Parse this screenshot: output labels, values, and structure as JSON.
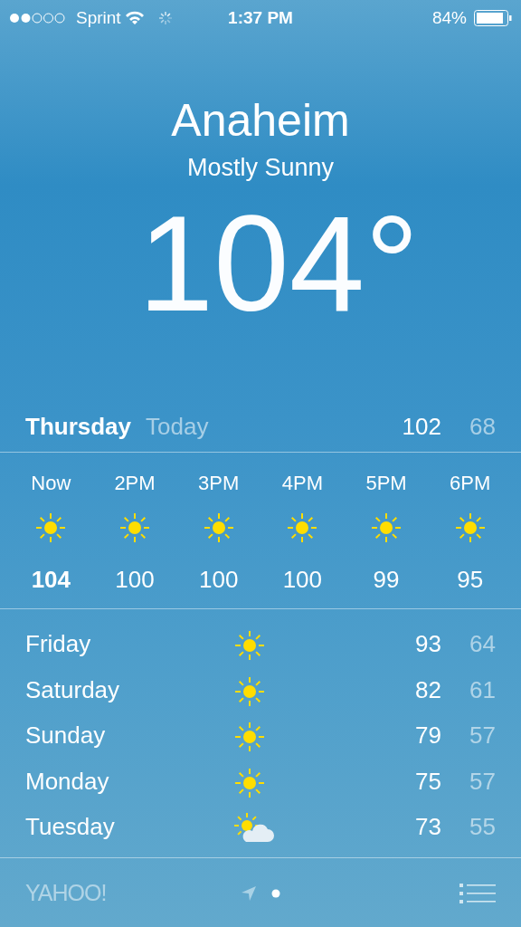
{
  "status_bar": {
    "carrier": "Sprint",
    "time": "1:37 PM",
    "battery": "84%"
  },
  "location": {
    "city": "Anaheim",
    "condition": "Mostly Sunny",
    "temperature": "104°"
  },
  "today": {
    "day": "Thursday",
    "label": "Today",
    "high": "102",
    "low": "68"
  },
  "hourly": [
    {
      "time": "Now",
      "kind": "sunny",
      "temp": "104",
      "current": true
    },
    {
      "time": "2PM",
      "kind": "sunny",
      "temp": "100",
      "current": false
    },
    {
      "time": "3PM",
      "kind": "sunny",
      "temp": "100",
      "current": false
    },
    {
      "time": "4PM",
      "kind": "sunny",
      "temp": "100",
      "current": false
    },
    {
      "time": "5PM",
      "kind": "sunny",
      "temp": "99",
      "current": false
    },
    {
      "time": "6PM",
      "kind": "sunny",
      "temp": "95",
      "current": false
    }
  ],
  "daily": [
    {
      "day": "Friday",
      "kind": "sunny",
      "high": "93",
      "low": "64"
    },
    {
      "day": "Saturday",
      "kind": "sunny",
      "high": "82",
      "low": "61"
    },
    {
      "day": "Sunday",
      "kind": "sunny",
      "high": "79",
      "low": "57"
    },
    {
      "day": "Monday",
      "kind": "sunny",
      "high": "75",
      "low": "57"
    },
    {
      "day": "Tuesday",
      "kind": "partly-cloudy",
      "high": "73",
      "low": "55"
    }
  ],
  "footer": {
    "brand": "YAHOO!"
  }
}
